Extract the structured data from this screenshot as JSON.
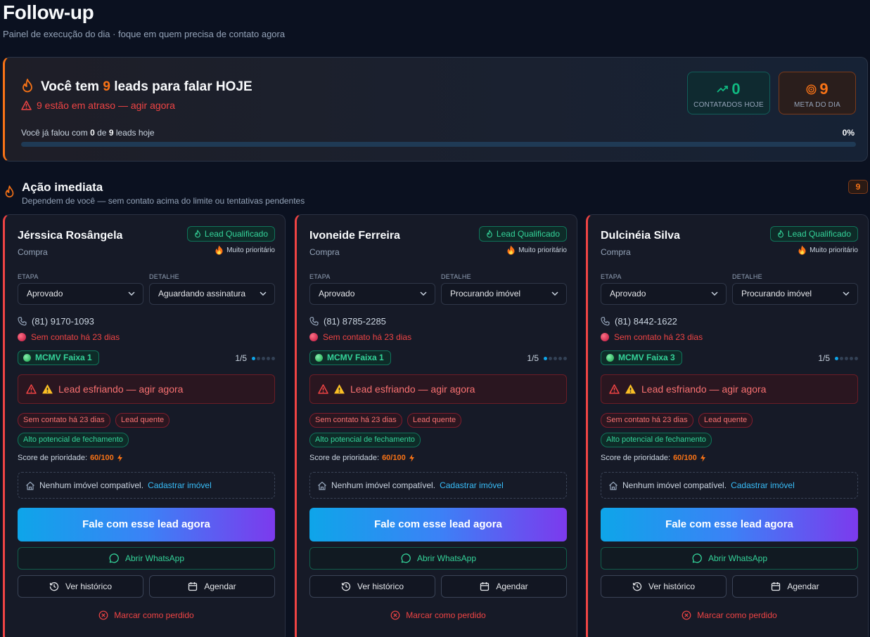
{
  "page": {
    "title": "Follow-up",
    "subtitle": "Painel de execução do dia · foque em quem precisa de contato agora"
  },
  "banner": {
    "title_prefix": "Você tem",
    "title_count": "9",
    "title_suffix": "leads para falar HOJE",
    "warning": "9 estão em atraso — agir agora",
    "contacted": {
      "value": "0",
      "label": "CONTATADOS HOJE"
    },
    "goal": {
      "value": "9",
      "label": "META DO DIA"
    },
    "progress_prefix": "Você já falou com",
    "progress_done": "0",
    "progress_mid": "de",
    "progress_total": "9",
    "progress_suffix": "leads hoje",
    "progress_percent_label": "0%",
    "progress_fraction": 0
  },
  "section": {
    "title": "Ação imediata",
    "subtitle": "Dependem de você — sem contato acima do limite ou tentativas pendentes",
    "count": "9"
  },
  "labels": {
    "etapa": "ETAPA",
    "detalhe": "DETALHE",
    "alert": "Lead esfriando — agir agora",
    "tag_no_contact": "Sem contato há 23 dias",
    "tag_hot": "Lead quente",
    "tag_potential": "Alto potencial de fechamento",
    "score_label": "Score de prioridade:",
    "score_value": "60/100",
    "no_property": "Nenhum imóvel compatível.",
    "register_property": "Cadastrar imóvel",
    "cta": "Fale com esse lead agora",
    "whatsapp": "Abrir WhatsApp",
    "history": "Ver histórico",
    "schedule": "Agendar",
    "mark_lost": "Marcar como perdido",
    "priority": "Muito prioritário",
    "step": "1/5"
  },
  "leads": [
    {
      "name": "Jérssica Rosângela",
      "intent": "Compra",
      "status": "Lead Qualificado",
      "etapa": "Aprovado",
      "detalhe": "Aguardando assinatura",
      "phone": "(81) 9170-1093",
      "no_contact": "Sem contato há 23 dias",
      "faixa": "MCMV Faixa 1"
    },
    {
      "name": "Ivoneide Ferreira",
      "intent": "Compra",
      "status": "Lead Qualificado",
      "etapa": "Aprovado",
      "detalhe": "Procurando imóvel",
      "phone": "(81) 8785-2285",
      "no_contact": "Sem contato há 23 dias",
      "faixa": "MCMV Faixa 1"
    },
    {
      "name": "Dulcinéia Silva",
      "intent": "Compra",
      "status": "Lead Qualificado",
      "etapa": "Aprovado",
      "detalhe": "Procurando imóvel",
      "phone": "(81) 8442-1622",
      "no_contact": "Sem contato há 23 dias",
      "faixa": "MCMV Faixa 3"
    }
  ],
  "colors": {
    "background": "#0b1120",
    "accent_orange": "#f97316",
    "danger": "#ef4444",
    "success": "#34d399",
    "link": "#38bdf8"
  }
}
